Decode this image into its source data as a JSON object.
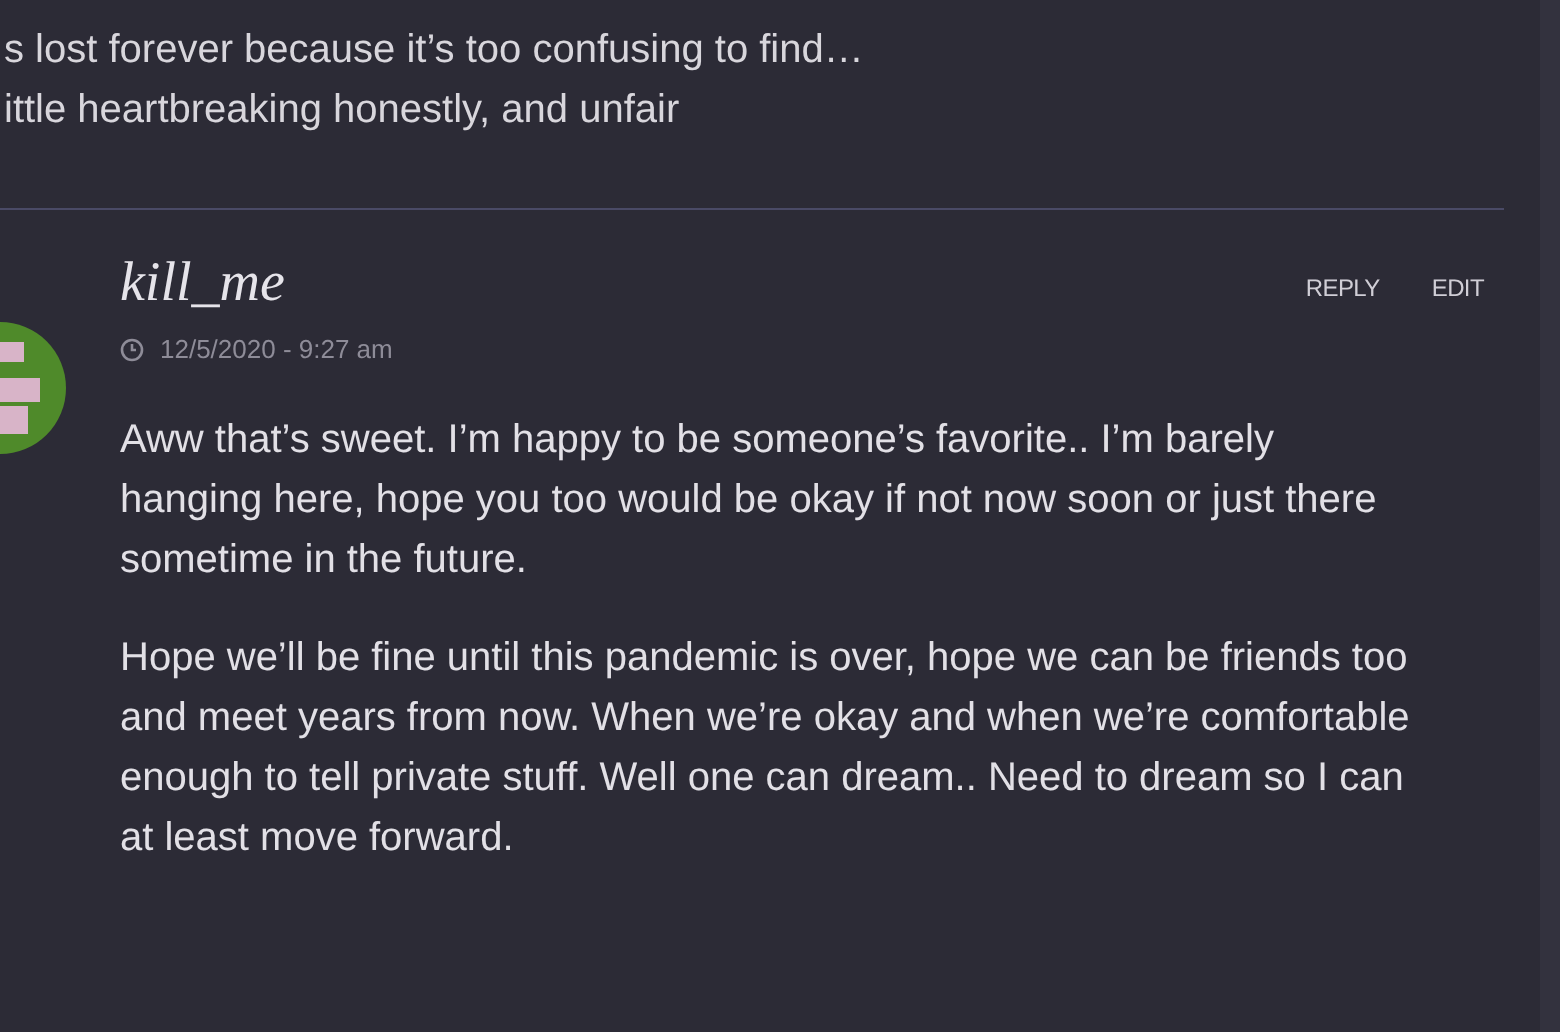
{
  "previous_comment": {
    "lines": [
      "s lost forever because it’s too confusing to find…",
      "ittle heartbreaking honestly, and unfair"
    ]
  },
  "comment": {
    "author": "kill_me",
    "date": "12/5/2020 - 9:27 am",
    "actions": [
      "REPLY",
      "EDIT"
    ],
    "paragraphs": [
      "Aww that’s sweet. I’m happy to be someone’s favorite.. I’m barely hanging here, hope you too would be okay if not now soon or just there sometime in the future.",
      "Hope we’ll be fine until this pandemic is over, hope we can be friends too and meet years from now. When we’re okay and when we’re comfortable enough to tell private stuff. Well one can dream.. Need to dream so I can at least move forward."
    ]
  }
}
